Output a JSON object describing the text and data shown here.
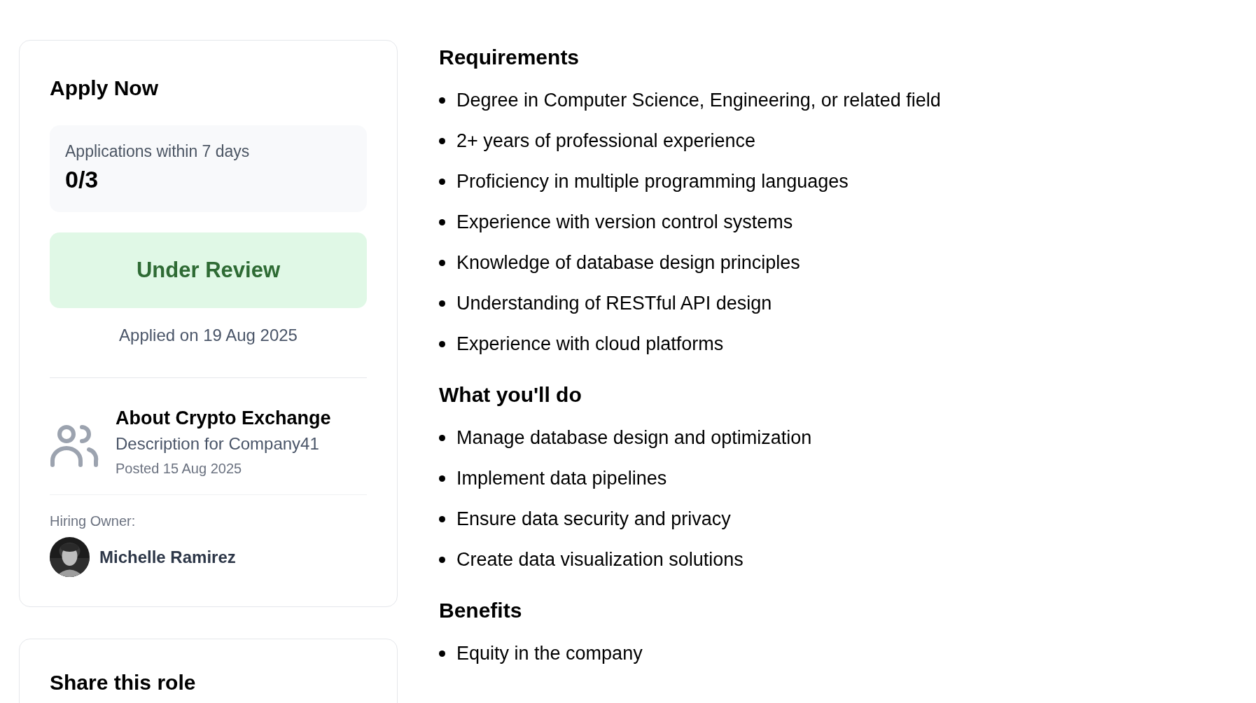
{
  "apply_card": {
    "title": "Apply Now",
    "stats": {
      "label": "Applications within 7 days",
      "value": "0/3"
    },
    "status": "Under Review",
    "applied_date": "Applied on 19 Aug 2025",
    "company": {
      "name": "About Crypto Exchange",
      "description": "Description for Company41",
      "posted": "Posted 15 Aug 2025"
    },
    "hiring_owner": {
      "label": "Hiring Owner:",
      "name": "Michelle Ramirez"
    }
  },
  "share_card": {
    "title": "Share this role"
  },
  "sections": [
    {
      "heading": "Requirements",
      "items": [
        "Degree in Computer Science, Engineering, or related field",
        "2+ years of professional experience",
        "Proficiency in multiple programming languages",
        "Experience with version control systems",
        "Knowledge of database design principles",
        "Understanding of RESTful API design",
        "Experience with cloud platforms"
      ]
    },
    {
      "heading": "What you'll do",
      "items": [
        "Manage database design and optimization",
        "Implement data pipelines",
        "Ensure data security and privacy",
        "Create data visualization solutions"
      ]
    },
    {
      "heading": "Benefits",
      "items": [
        "Equity in the company"
      ]
    }
  ]
}
